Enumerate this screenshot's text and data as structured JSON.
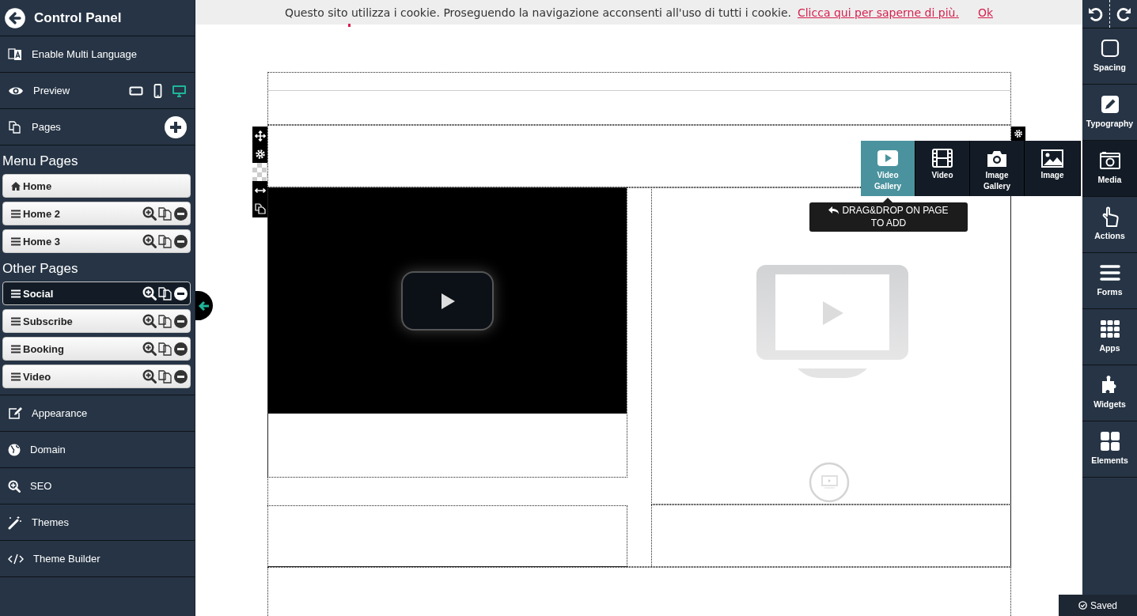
{
  "sidebar": {
    "title": "Control Panel",
    "top_items": [
      {
        "label": "Enable Multi Language"
      },
      {
        "label": "Preview",
        "devices": [
          {
            "selected": false
          },
          {
            "selected": false
          },
          {
            "selected": true
          }
        ]
      },
      {
        "label": "Pages"
      }
    ],
    "menu_pages": {
      "heading": "Menu Pages",
      "items": [
        {
          "label": "Home",
          "kind": "home",
          "selected": false
        },
        {
          "label": "Home 2",
          "kind": "page",
          "selected": false
        },
        {
          "label": "Home 3",
          "kind": "page",
          "selected": false
        }
      ]
    },
    "other_pages": {
      "heading": "Other Pages",
      "items": [
        {
          "label": "Social",
          "kind": "page",
          "selected": true
        },
        {
          "label": "Subscribe",
          "kind": "page",
          "selected": false
        },
        {
          "label": "Booking",
          "kind": "page",
          "selected": false
        },
        {
          "label": "Video",
          "kind": "page",
          "selected": false
        }
      ]
    },
    "bottom_items": [
      {
        "label": "Appearance"
      },
      {
        "label": "Domain"
      },
      {
        "label": "SEO"
      },
      {
        "label": "Themes"
      },
      {
        "label": "Theme Builder"
      }
    ]
  },
  "cookie_bar": {
    "text": "Questo sito utilizza i cookie. Proseguendo la navigazione acconsenti all'uso di tutti i cookie.",
    "link": "Clicca qui per saperne di più.",
    "ok": "Ok"
  },
  "media_panel": {
    "items": [
      {
        "label": "Video Gallery",
        "selected": true
      },
      {
        "label": "Video",
        "selected": false
      },
      {
        "label": "Image Gallery",
        "selected": false
      },
      {
        "label": "Image",
        "selected": false
      }
    ],
    "tooltip": "DRAG&DROP ON PAGE TO ADD"
  },
  "toolbar": {
    "items": [
      {
        "label": "Spacing",
        "selected": false
      },
      {
        "label": "Typography",
        "selected": false
      },
      {
        "label": "Media",
        "selected": true
      },
      {
        "label": "Actions",
        "selected": false
      },
      {
        "label": "Forms",
        "selected": false
      },
      {
        "label": "Apps",
        "selected": false
      },
      {
        "label": "Widgets",
        "selected": false
      },
      {
        "label": "Elements",
        "selected": false
      }
    ]
  },
  "status": "Saved"
}
